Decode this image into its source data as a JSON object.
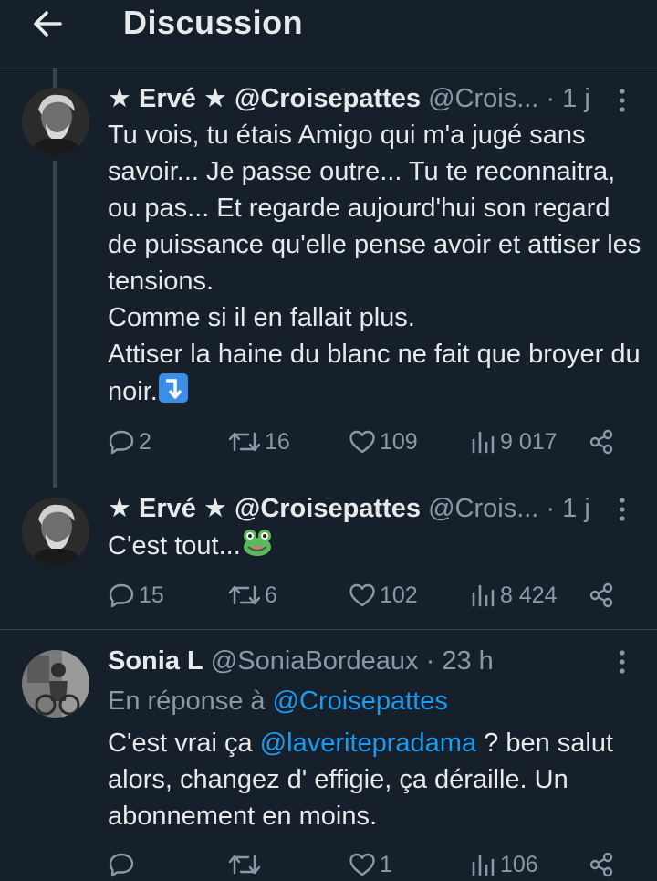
{
  "header": {
    "title": "Discussion",
    "back_icon": "arrow-left-icon"
  },
  "tweets": [
    {
      "name": "★ Ervé ★ @Croisepattes",
      "handle": "@Crois...",
      "sep": "·",
      "time": "1 j",
      "text": "Tu vois, tu étais Amigo qui m'a jugé sans savoir... Je passe outre... Tu te reconnaitra, ou pas... Et regarde aujourd'hui son regard de puissance qu'elle pense avoir et attiser les tensions.\nComme si il en fallait plus.\nAttiser la haine du blanc ne fait que broyer du noir.",
      "emoji": "arrow-down-right-emoji",
      "replies": "2",
      "retweets": "16",
      "likes": "109",
      "views": "9 017"
    },
    {
      "name": "★ Ervé ★ @Croisepattes",
      "handle": "@Crois...",
      "sep": "·",
      "time": "1 j",
      "text": "C'est tout...",
      "emoji": "frog-emoji",
      "replies": "15",
      "retweets": "6",
      "likes": "102",
      "views": "8 424"
    },
    {
      "name": "Sonia L",
      "handle": "@SoniaBordeaux",
      "sep": "·",
      "time": "23 h",
      "reply_prefix": "En réponse à",
      "reply_handle": "@Croisepattes",
      "text_pre": "C'est vrai ça ",
      "mention": "@laveritepradama",
      "text_post": " ? ben salut alors, changez d' effigie, ça déraille. Un abonnement en moins.",
      "replies": "",
      "retweets": "",
      "likes": "1",
      "views": "106"
    }
  ],
  "colors": {
    "background": "#15202b",
    "text": "#e7e9ea",
    "muted": "#8b98a5",
    "link": "#1d9bf0",
    "border": "#38444d"
  }
}
